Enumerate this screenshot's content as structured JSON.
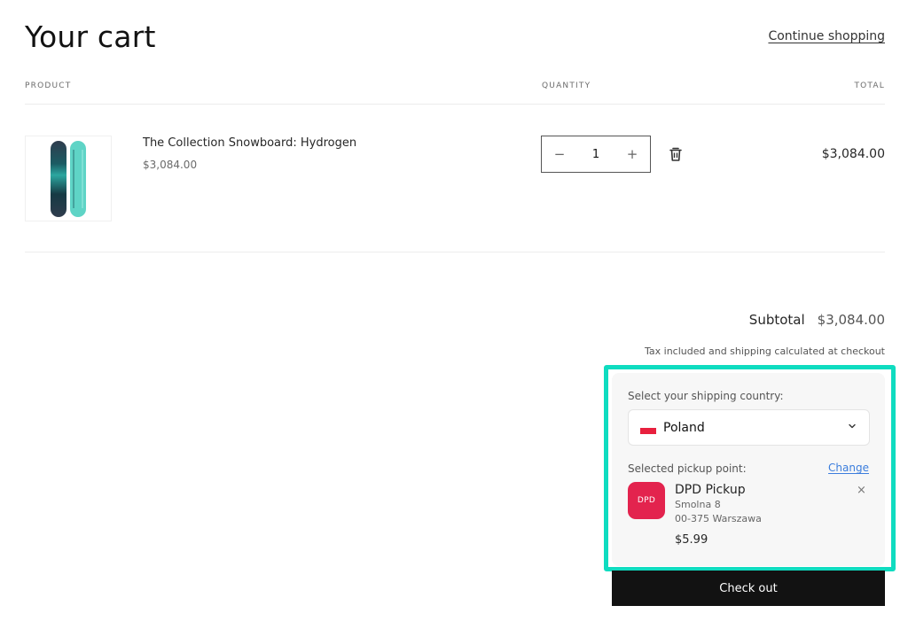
{
  "header": {
    "title": "Your cart",
    "continue_shopping": "Continue shopping"
  },
  "table": {
    "columns": [
      "Product",
      "Quantity",
      "Total"
    ]
  },
  "items": [
    {
      "name": "The Collection Snowboard: Hydrogen",
      "price": "$3,084.00",
      "quantity": "1",
      "line_total": "$3,084.00",
      "qty_decrease": "−",
      "qty_increase": "+"
    }
  ],
  "summary": {
    "subtotal_label": "Subtotal",
    "subtotal_value": "$3,084.00",
    "tax_note": "Tax included and shipping calculated at checkout"
  },
  "shipping": {
    "country_label": "Select your shipping country:",
    "country_value": "Poland",
    "pickup_label": "Selected pickup point:",
    "change_label": "Change",
    "pickup": {
      "logo_text": "DPD",
      "name": "DPD Pickup",
      "street": "Smolna 8",
      "city": "00-375 Warszawa",
      "price": "$5.99",
      "remove": "×"
    },
    "highlight_color": "#0fdcc0",
    "logo_color": "#e3234e"
  },
  "checkout_label": "Check out"
}
